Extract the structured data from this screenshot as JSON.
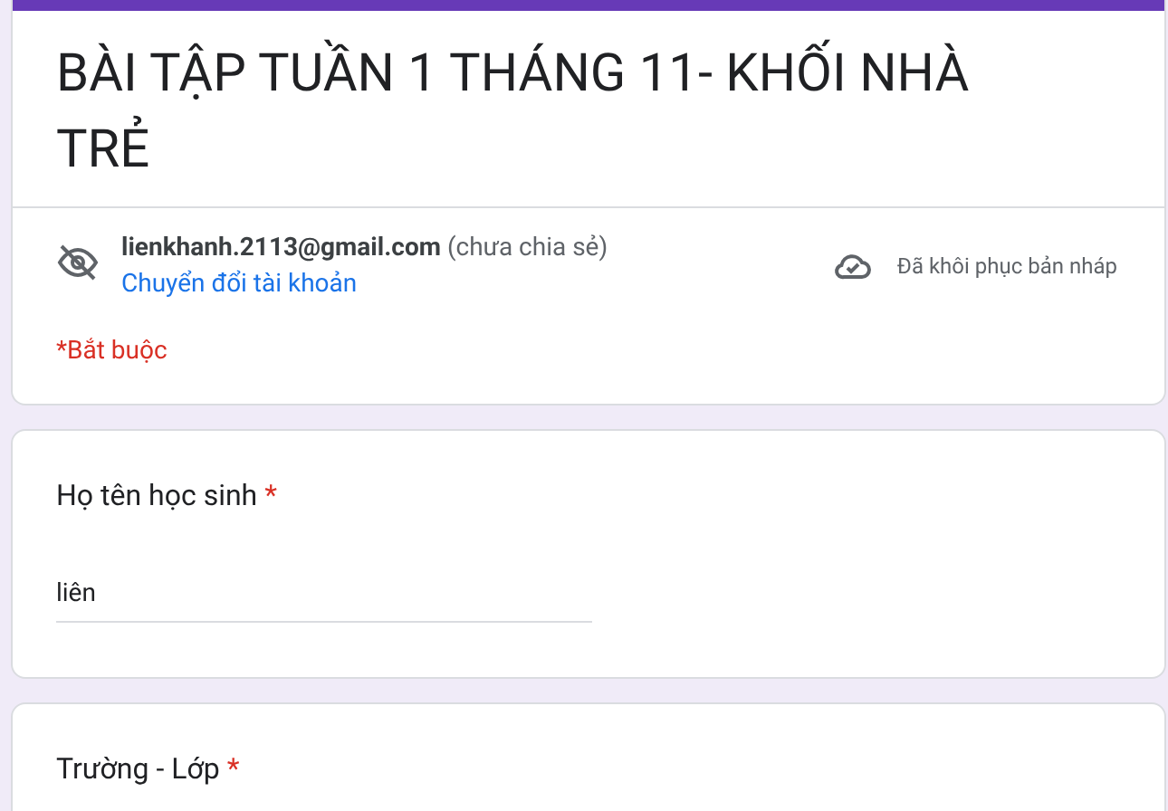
{
  "header": {
    "title": "BÀI TẬP TUẦN 1 THÁNG 11- KHỐI NHÀ TRẺ",
    "account_email": "lienkhanh.2113@gmail.com",
    "account_note": "(chưa chia sẻ)",
    "switch_account_link": "Chuyển đổi tài khoản",
    "draft_status": "Đã khôi phục bản nháp",
    "required_note": "*Bắt buộc"
  },
  "questions": [
    {
      "label": "Họ tên học sinh",
      "required_mark": "*",
      "answer": "liên"
    },
    {
      "label": "Trường - Lớp",
      "required_mark": "*"
    }
  ]
}
